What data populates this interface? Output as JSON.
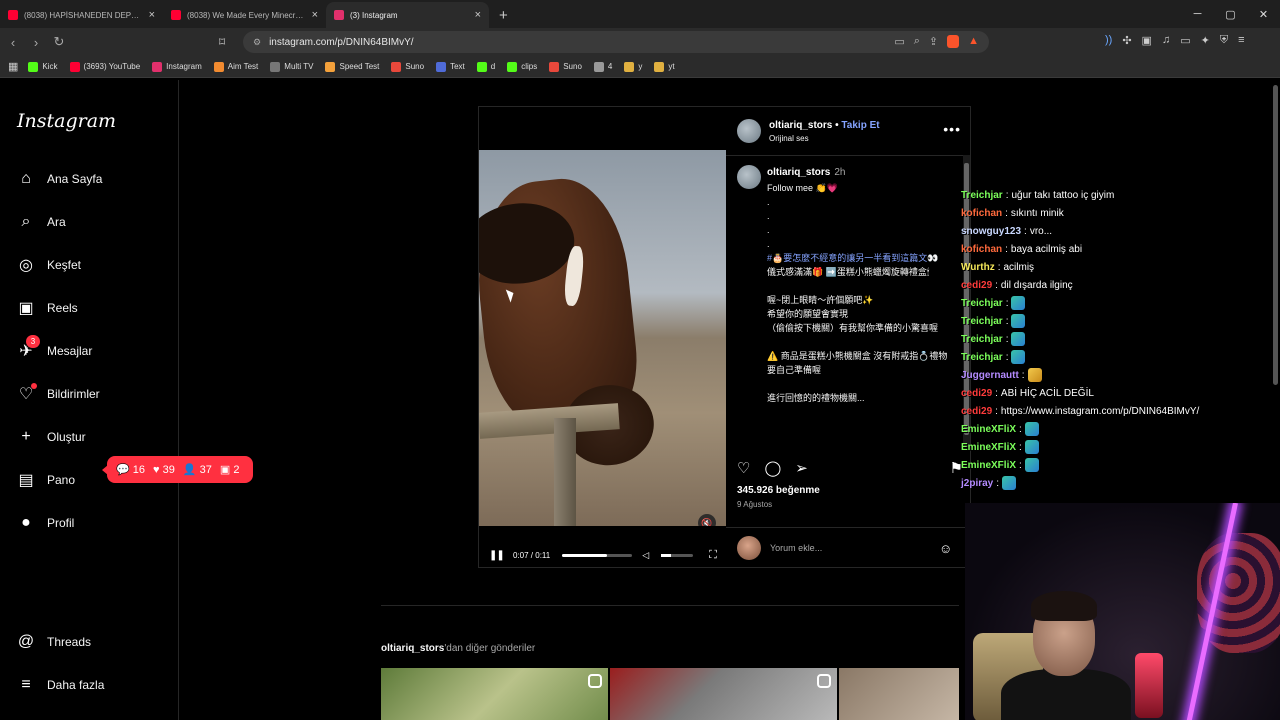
{
  "browser": {
    "tabs": [
      {
        "title": "(8038) HAPİSHANEDEN DEPO ALDIK",
        "icon": "youtube-icon",
        "color": "#ff0033"
      },
      {
        "title": "(8038) We Made Every Minecraft Sw",
        "icon": "youtube-icon",
        "color": "#ff0033"
      },
      {
        "title": "(3) Instagram",
        "icon": "instagram-icon",
        "color": "#e1306c"
      }
    ],
    "new_tab": "+",
    "url": "instagram.com/p/DNIN64BIMvY/",
    "bookmarks": [
      {
        "label": "Kick",
        "color": "#53fc18"
      },
      {
        "label": "(3693) YouTube",
        "color": "#ff0033"
      },
      {
        "label": "Instagram",
        "color": "#e1306c"
      },
      {
        "label": "Aim Test",
        "color": "#f28b30"
      },
      {
        "label": "Multi TV",
        "color": "#777777"
      },
      {
        "label": "Speed Test",
        "color": "#f4a13b"
      },
      {
        "label": "Suno",
        "color": "#e8483b"
      },
      {
        "label": "Text",
        "color": "#4f6bd8"
      },
      {
        "label": "d",
        "color": "#53fc18"
      },
      {
        "label": "clips",
        "color": "#53fc18"
      },
      {
        "label": "Suno",
        "color": "#e8483b"
      },
      {
        "label": "4",
        "color": "#999999"
      },
      {
        "label": "y",
        "color": "#e0b040"
      },
      {
        "label": "yt",
        "color": "#e0b040"
      }
    ]
  },
  "sidebar": {
    "logo": "Instagram",
    "items": [
      {
        "label": "Ana Sayfa",
        "icon": "home-icon",
        "glyph": "⌂"
      },
      {
        "label": "Ara",
        "icon": "search-icon",
        "glyph": "⌕"
      },
      {
        "label": "Keşfet",
        "icon": "compass-icon",
        "glyph": "◎"
      },
      {
        "label": "Reels",
        "icon": "reels-icon",
        "glyph": "▣"
      },
      {
        "label": "Mesajlar",
        "icon": "messenger-icon",
        "glyph": "✈",
        "badge": "3"
      },
      {
        "label": "Bildirimler",
        "icon": "heart-icon",
        "glyph": "♡",
        "dot": true
      },
      {
        "label": "Oluştur",
        "icon": "plus-icon",
        "glyph": "+"
      },
      {
        "label": "Pano",
        "icon": "dashboard-icon",
        "glyph": "▤"
      },
      {
        "label": "Profil",
        "icon": "profile-avatar-icon",
        "glyph": "●"
      }
    ],
    "bottom_items": [
      {
        "label": "Threads",
        "icon": "threads-icon",
        "glyph": "@"
      },
      {
        "label": "Daha fazla",
        "icon": "menu-icon",
        "glyph": "≡"
      }
    ],
    "notifications": {
      "comments": "16",
      "likes": "39",
      "follows": "37",
      "tags": "2"
    }
  },
  "post": {
    "username": "oltiariq_stors",
    "follow_label": "Takip Et",
    "audio": "Orijinal ses",
    "caption_time": "2h",
    "caption_lines": [
      "Follow mee 👏💗",
      ".",
      ".",
      ".",
      ".",
      "#🎂要怎麼不經意的讓另一半看到這篇文👀",
      "儀式感滿滿🎁 ➡️蛋糕小熊蠟燭旋轉禮盒🕯",
      "",
      "喔~閉上眼睛～許個願吧✨",
      "希望你的願望會實現",
      "（偷偷按下機關）有我幫你準備的小驚喜喔",
      "",
      "⚠️ 商品是蛋糕小熊機關盒 沒有附戒指💍禮物要自己準備喔",
      "",
      "進行回憶的的禮物機關..."
    ],
    "video": {
      "current": "0:07",
      "duration": "0:11",
      "progress": 0.64,
      "volume": 0.3
    },
    "likes": "345.926 beğenme",
    "date": "9 Ağustos",
    "comment_placeholder": "Yorum ekle..."
  },
  "more_posts": {
    "username": "oltiariq_stors",
    "suffix": "'dan diğer gönderiler"
  },
  "chat": [
    {
      "user": "Treichjar",
      "color": "#7cff5b",
      "text": "uğur takı tattoo iç giyim"
    },
    {
      "user": "kofichan",
      "color": "#ff6a3d",
      "text": "sıkıntı minik"
    },
    {
      "user": "snowguy123",
      "color": "#c9d8ff",
      "text": "vro..."
    },
    {
      "user": "kofichan",
      "color": "#ff6a3d",
      "text": "baya acilmiş abi"
    },
    {
      "user": "Wurthz",
      "color": "#f5e85a",
      "text": "acilmiş"
    },
    {
      "user": "cedi29",
      "color": "#ff3b3b",
      "text": "dil dışarda ilginç"
    },
    {
      "user": "Treichjar",
      "color": "#7cff5b",
      "text": "",
      "emote": true
    },
    {
      "user": "Treichjar",
      "color": "#7cff5b",
      "text": "",
      "emote": true
    },
    {
      "user": "Treichjar",
      "color": "#7cff5b",
      "text": "",
      "emote": true
    },
    {
      "user": "Treichjar",
      "color": "#7cff5b",
      "text": "",
      "emote": true
    },
    {
      "user": "Juggernautt",
      "color": "#b48bff",
      "text": "",
      "emote": true
    },
    {
      "user": "cedi29",
      "color": "#ff3b3b",
      "text": "ABİ HİÇ ACİL DEĞİL"
    },
    {
      "user": "cedi29",
      "color": "#ff3b3b",
      "text": "https://www.instagram.com/p/DNIN64BIMvY/"
    },
    {
      "user": "EmineXFliX",
      "color": "#7cff5b",
      "text": "",
      "emote": true
    },
    {
      "user": "EmineXFliX",
      "color": "#7cff5b",
      "text": "",
      "emote": true
    },
    {
      "user": "EmineXFliX",
      "color": "#7cff5b",
      "text": "",
      "emote": true
    },
    {
      "user": "j2piray",
      "color": "#b48bff",
      "text": "",
      "emote": true
    }
  ]
}
